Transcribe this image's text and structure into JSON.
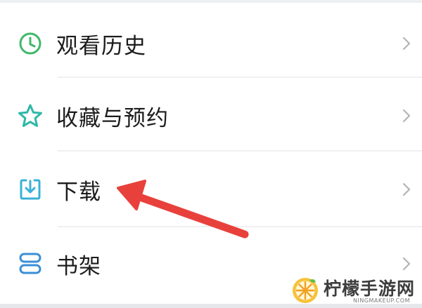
{
  "menu": {
    "items": [
      {
        "label": "观看历史",
        "icon": "clock-icon"
      },
      {
        "label": "收藏与预约",
        "icon": "star-icon"
      },
      {
        "label": "下载",
        "icon": "download-icon"
      },
      {
        "label": "书架",
        "icon": "bookshelf-icon"
      }
    ]
  },
  "annotation": {
    "icon": "red-arrow-icon",
    "color": "#e8413c"
  },
  "watermark": {
    "title": "柠檬手游网",
    "subtitle": "NINGMAKEUP.COM",
    "logo_icon": "lemon-logo-icon"
  },
  "colors": {
    "clock": "#3fb86a",
    "star": "#2fb8a8",
    "download": "#3ab0d8",
    "bookshelf": "#3a8fd6",
    "chevron": "#b4b4b4"
  }
}
